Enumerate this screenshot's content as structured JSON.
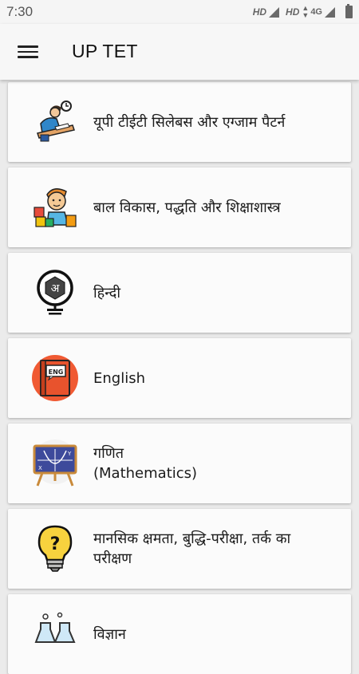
{
  "status_bar": {
    "time": "7:30",
    "hd1": "HD",
    "hd2": "HD",
    "network": "4G"
  },
  "app_bar": {
    "title": "UP TET"
  },
  "items": [
    {
      "label": "यूपी टीईटी सिलेबस और एग्जाम पैटर्न",
      "icon": "student-writing-icon"
    },
    {
      "label": "बाल विकास, पद्धति और शिक्षाशास्त्र",
      "icon": "child-blocks-icon"
    },
    {
      "label": "हिन्दी",
      "icon": "hindi-letter-icon"
    },
    {
      "label": "English",
      "icon": "english-book-icon"
    },
    {
      "label": "गणित\n(Mathematics)",
      "icon": "math-board-icon"
    },
    {
      "label": "मानसिक क्षमता, बुद्धि-परीक्षा, तर्क का परीक्षण",
      "icon": "lightbulb-question-icon"
    },
    {
      "label": "विज्ञान",
      "icon": "science-flask-icon"
    }
  ]
}
